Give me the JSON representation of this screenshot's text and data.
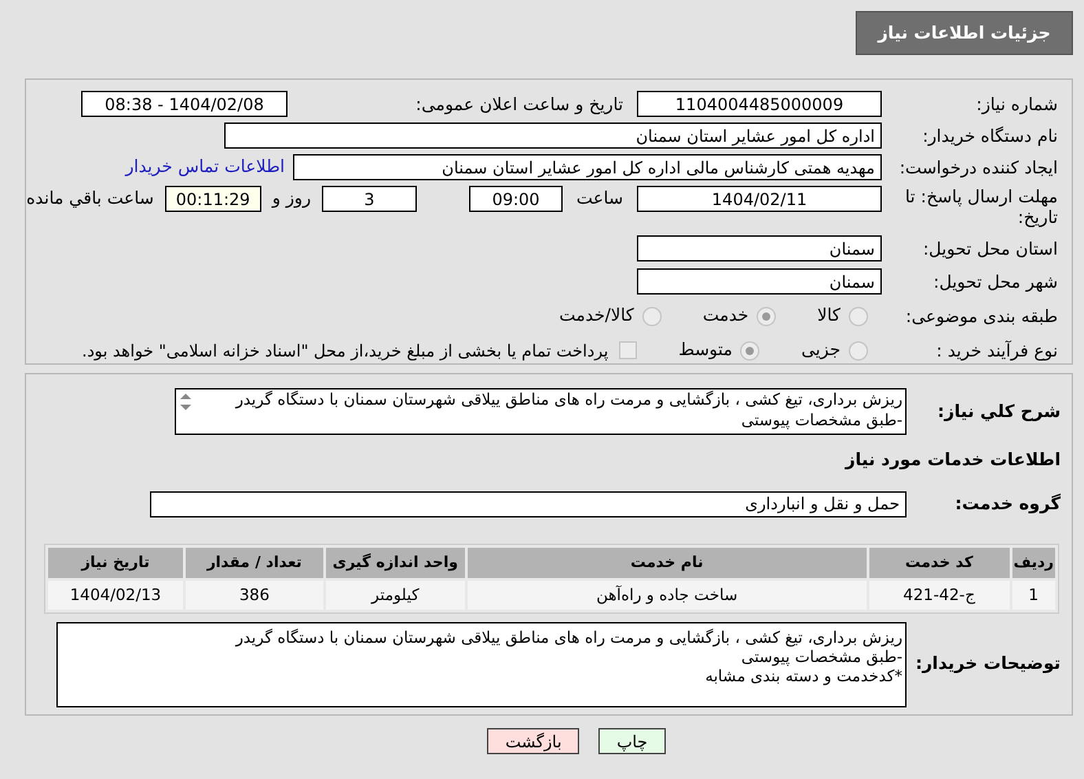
{
  "page_title": "جزئیات اطلاعات نیاز",
  "need_number": {
    "label": "شماره نیاز:",
    "value": "1104004485000009"
  },
  "announce_datetime": {
    "label": "تاریخ و ساعت اعلان عمومی:",
    "value": "1404/02/08 - 08:38"
  },
  "buyer_org": {
    "label": "نام دستگاه خریدار:",
    "value": "اداره کل امور عشایر استان سمنان"
  },
  "requester": {
    "label": "ایجاد کننده درخواست:",
    "value": "مهدیه همتی کارشناس مالی اداره کل امور عشایر استان سمنان",
    "link": "اطلاعات تماس خریدار"
  },
  "deadline": {
    "label": "مهلت ارسال پاسخ: تا تاریخ:",
    "date": "1404/02/11",
    "time_label": "ساعت",
    "time": "09:00",
    "days": "3",
    "days_label": "روز و",
    "remaining": "00:11:29",
    "remaining_label": "ساعت باقي مانده"
  },
  "province": {
    "label": "استان محل تحویل:",
    "value": "سمنان"
  },
  "city": {
    "label": "شهر محل تحویل:",
    "value": "سمنان"
  },
  "category": {
    "label": "طبقه بندی موضوعی:",
    "options": [
      {
        "label": "کالا",
        "selected": false
      },
      {
        "label": "خدمت",
        "selected": true
      },
      {
        "label": "کالا/خدمت",
        "selected": false
      }
    ]
  },
  "process": {
    "label": "نوع فرآیند خرید :",
    "options": [
      {
        "label": "جزیی",
        "selected": false
      },
      {
        "label": "متوسط",
        "selected": true
      }
    ],
    "payment": {
      "label": "پرداخت تمام یا بخشی از مبلغ خرید،از محل \"اسناد خزانه اسلامی\" خواهد بود.",
      "checked": false
    }
  },
  "description": {
    "label": "شرح کلي نياز:",
    "lines": [
      "ریزش برداری، تیغ کشی ، بازگشایی و مرمت راه های مناطق ییلاقی شهرستان سمنان با دستگاه گریدر",
      "-طبق مشخصات پیوستی"
    ]
  },
  "section_title": "اطلاعات خدمات مورد نياز",
  "service_group": {
    "label": "گروه خدمت:",
    "value": "حمل و نقل و انبارداری"
  },
  "table": {
    "columns": [
      "ردیف",
      "کد خدمت",
      "نام خدمت",
      "واحد اندازه گیری",
      "تعداد / مقدار",
      "تاریخ نیاز"
    ],
    "rows": [
      [
        "1",
        "ج-42-421",
        "ساخت جاده و راه‌آهن",
        "کیلومتر",
        "386",
        "1404/02/13"
      ]
    ]
  },
  "buyer_notes": {
    "label": "توضیحات خریدار:",
    "lines": [
      "ریزش برداری، تیغ کشی ، بازگشایی و مرمت راه های مناطق ییلاقی شهرستان سمنان با دستگاه گریدر",
      "-طبق مشخصات پیوستی",
      "*کدخدمت و دسته بندی مشابه"
    ]
  },
  "buttons": [
    {
      "label": "چاپ",
      "kind": "print"
    },
    {
      "label": "بازگشت",
      "kind": "back"
    }
  ]
}
